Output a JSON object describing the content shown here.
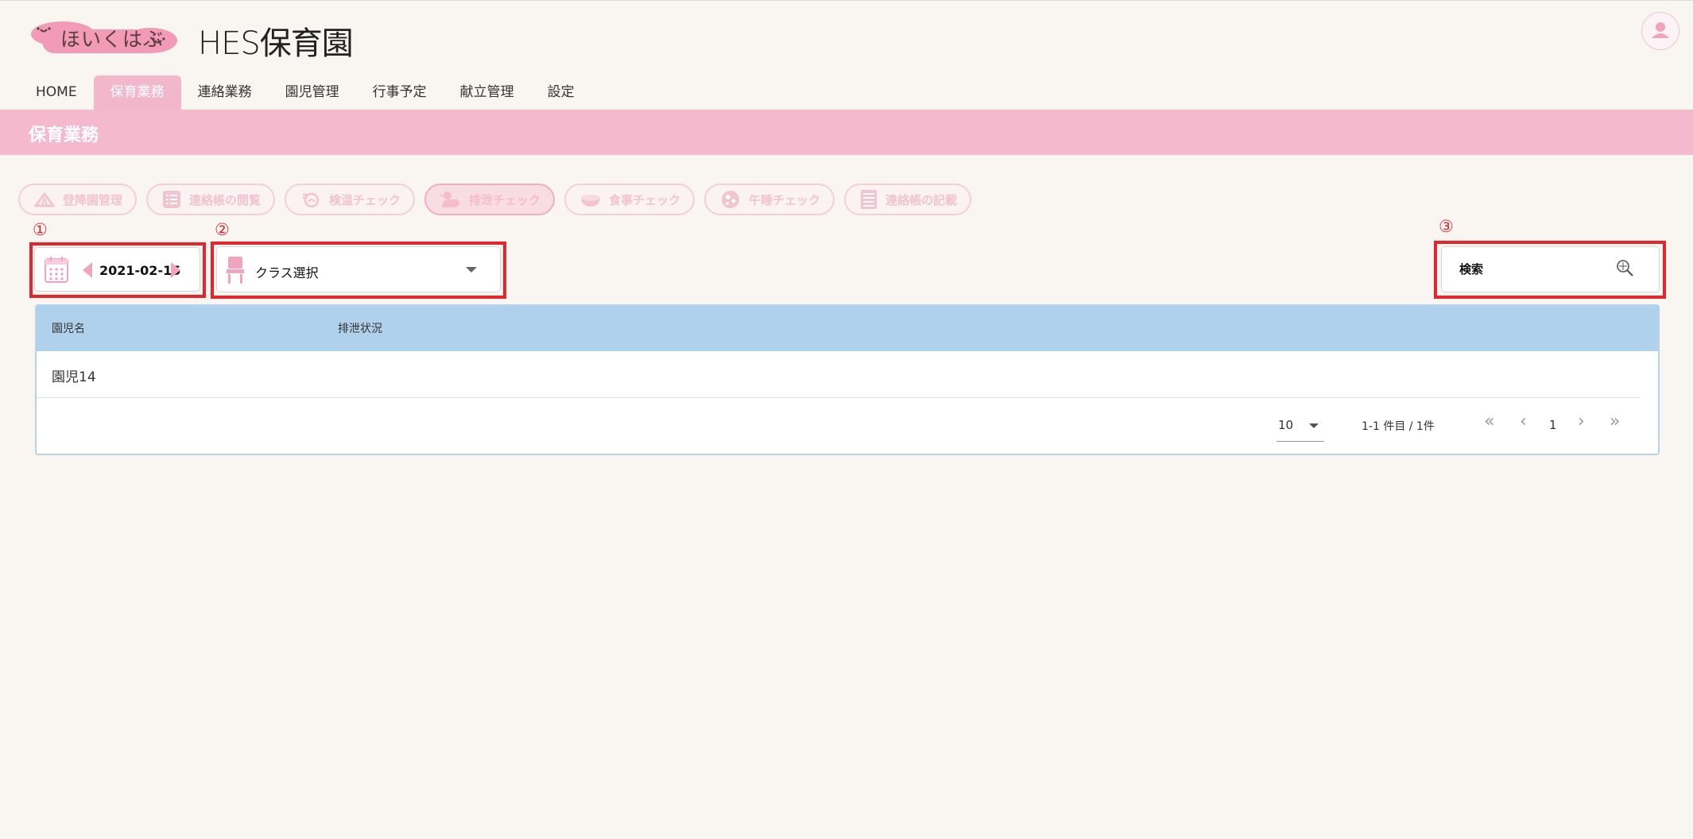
{
  "brand": {
    "logo_text": "ほいくはぶ",
    "site_title": "HES保育園"
  },
  "nav": {
    "tabs": [
      "HOME",
      "保育業務",
      "連絡業務",
      "園児管理",
      "行事予定",
      "献立管理",
      "設定"
    ],
    "active": "保育業務"
  },
  "section": {
    "title": "保育業務"
  },
  "functions": [
    {
      "label": "登降園管理",
      "icon": "tent-icon"
    },
    {
      "label": "連絡帳の閲覧",
      "icon": "list-icon"
    },
    {
      "label": "検温チェック",
      "icon": "thermometer-icon"
    },
    {
      "label": "排泄チェック",
      "icon": "duck-icon",
      "active": true
    },
    {
      "label": "食事チェック",
      "icon": "bowl-icon"
    },
    {
      "label": "午睡チェック",
      "icon": "sleep-icon"
    },
    {
      "label": "連絡帳の記載",
      "icon": "notebook-icon"
    }
  ],
  "annotations": {
    "n1": "①",
    "n2": "②",
    "n3": "③"
  },
  "date_picker": {
    "value": "2021-02-15"
  },
  "class_select": {
    "value": "クラス選択"
  },
  "search": {
    "placeholder": "検索"
  },
  "table": {
    "columns": [
      "園児名",
      "排泄状況"
    ],
    "rows": [
      {
        "name": "園児14",
        "status": ""
      }
    ]
  },
  "pagination": {
    "rows_per_page": "10",
    "range": "1-1 件目 / 1件",
    "current_page": "1",
    "first": "«",
    "prev": "‹",
    "next": "›",
    "last": "»"
  },
  "colors": {
    "accent_pink": "#f4b9cc",
    "nav_active": "#f3b7cb",
    "table_header": "#b0d1ec",
    "annotation_red": "#e4262c",
    "background": "#f9f6f2"
  }
}
